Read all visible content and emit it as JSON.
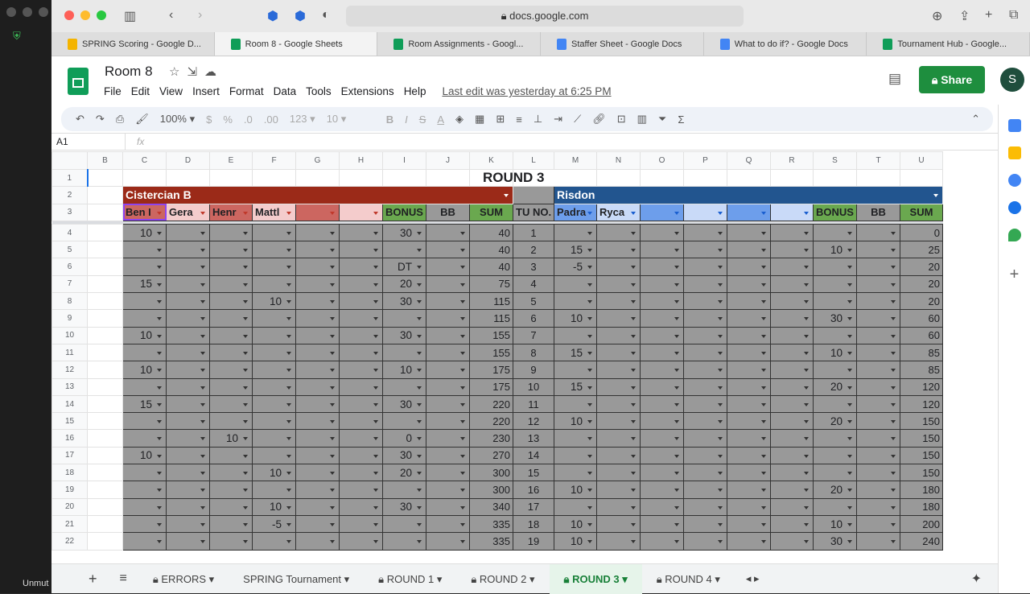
{
  "browser": {
    "url": "docs.google.com",
    "tabs": [
      {
        "label": "SPRING Scoring - Google D...",
        "icon": "drive-icon",
        "color": "#f4b400"
      },
      {
        "label": "Room 8 - Google Sheets",
        "icon": "sheets-icon",
        "color": "#0f9d58",
        "active": true
      },
      {
        "label": "Room Assignments - Googl...",
        "icon": "sheets-icon",
        "color": "#0f9d58"
      },
      {
        "label": "Staffer Sheet - Google Docs",
        "icon": "docs-icon",
        "color": "#4285f4"
      },
      {
        "label": "What to do if? - Google Docs",
        "icon": "docs-icon",
        "color": "#4285f4"
      },
      {
        "label": "Tournament Hub - Google...",
        "icon": "sheets-icon",
        "color": "#0f9d58"
      }
    ]
  },
  "doc": {
    "title": "Room 8",
    "menu": [
      "File",
      "Edit",
      "View",
      "Insert",
      "Format",
      "Data",
      "Tools",
      "Extensions",
      "Help"
    ],
    "last_edit": "Last edit was yesterday at 6:25 PM",
    "share": "Share",
    "avatar": "S"
  },
  "toolbar": {
    "zoom": "100%",
    "currency": "$",
    "percent": "%",
    "dec_less": ".0",
    "dec_more": ".00",
    "format": "123",
    "font_size": "10"
  },
  "formula": {
    "cell": "A1",
    "value": ""
  },
  "zoom_app": {
    "unmute": "Unmut"
  },
  "sheet": {
    "columns": [
      "B",
      "C",
      "D",
      "E",
      "F",
      "G",
      "H",
      "I",
      "J",
      "K",
      "L",
      "M",
      "N",
      "O",
      "P",
      "Q",
      "R",
      "S",
      "T",
      "U"
    ],
    "title": "ROUND 3",
    "team1": "Cistercian B",
    "team2": "Risdon",
    "team1_players": [
      "Ben I",
      "Gera",
      "Henr",
      "Mattl",
      "",
      ""
    ],
    "team2_players": [
      "Padra",
      "Ryca",
      "",
      "",
      "",
      ""
    ],
    "bonus": "BONUS",
    "bb": "BB",
    "sum": "SUM",
    "tu": "TU NO.",
    "rows": [
      {
        "n": "4",
        "t1": [
          "10",
          "",
          "",
          "",
          "",
          ""
        ],
        "b1": "30",
        "s1": "40",
        "tu": "1",
        "t2": [
          "",
          "",
          "",
          "",
          "",
          ""
        ],
        "b2": "",
        "s2": "0"
      },
      {
        "n": "5",
        "t1": [
          "",
          "",
          "",
          "",
          "",
          ""
        ],
        "b1": "",
        "s1": "40",
        "tu": "2",
        "t2": [
          "15",
          "",
          "",
          "",
          "",
          ""
        ],
        "b2": "10",
        "s2": "25"
      },
      {
        "n": "6",
        "t1": [
          "",
          "",
          "",
          "",
          "",
          ""
        ],
        "b1": "DT",
        "s1": "40",
        "tu": "3",
        "t2": [
          "-5",
          "",
          "",
          "",
          "",
          ""
        ],
        "b2": "",
        "s2": "20"
      },
      {
        "n": "7",
        "t1": [
          "15",
          "",
          "",
          "",
          "",
          ""
        ],
        "b1": "20",
        "s1": "75",
        "tu": "4",
        "t2": [
          "",
          "",
          "",
          "",
          "",
          ""
        ],
        "b2": "",
        "s2": "20"
      },
      {
        "n": "8",
        "t1": [
          "",
          "",
          "",
          "10",
          "",
          ""
        ],
        "b1": "30",
        "s1": "115",
        "tu": "5",
        "t2": [
          "",
          "",
          "",
          "",
          "",
          ""
        ],
        "b2": "",
        "s2": "20"
      },
      {
        "n": "9",
        "t1": [
          "",
          "",
          "",
          "",
          "",
          ""
        ],
        "b1": "",
        "s1": "115",
        "tu": "6",
        "t2": [
          "10",
          "",
          "",
          "",
          "",
          ""
        ],
        "b2": "30",
        "s2": "60"
      },
      {
        "n": "10",
        "t1": [
          "10",
          "",
          "",
          "",
          "",
          ""
        ],
        "b1": "30",
        "s1": "155",
        "tu": "7",
        "t2": [
          "",
          "",
          "",
          "",
          "",
          ""
        ],
        "b2": "",
        "s2": "60"
      },
      {
        "n": "11",
        "t1": [
          "",
          "",
          "",
          "",
          "",
          ""
        ],
        "b1": "",
        "s1": "155",
        "tu": "8",
        "t2": [
          "15",
          "",
          "",
          "",
          "",
          ""
        ],
        "b2": "10",
        "s2": "85"
      },
      {
        "n": "12",
        "t1": [
          "10",
          "",
          "",
          "",
          "",
          ""
        ],
        "b1": "10",
        "s1": "175",
        "tu": "9",
        "t2": [
          "",
          "",
          "",
          "",
          "",
          ""
        ],
        "b2": "",
        "s2": "85"
      },
      {
        "n": "13",
        "t1": [
          "",
          "",
          "",
          "",
          "",
          ""
        ],
        "b1": "",
        "s1": "175",
        "tu": "10",
        "t2": [
          "15",
          "",
          "",
          "",
          "",
          ""
        ],
        "b2": "20",
        "s2": "120"
      },
      {
        "n": "14",
        "t1": [
          "15",
          "",
          "",
          "",
          "",
          ""
        ],
        "b1": "30",
        "s1": "220",
        "tu": "11",
        "t2": [
          "",
          "",
          "",
          "",
          "",
          ""
        ],
        "b2": "",
        "s2": "120"
      },
      {
        "n": "15",
        "t1": [
          "",
          "",
          "",
          "",
          "",
          ""
        ],
        "b1": "",
        "s1": "220",
        "tu": "12",
        "t2": [
          "10",
          "",
          "",
          "",
          "",
          ""
        ],
        "b2": "20",
        "s2": "150"
      },
      {
        "n": "16",
        "t1": [
          "",
          "",
          "10",
          "",
          "",
          ""
        ],
        "b1": "0",
        "s1": "230",
        "tu": "13",
        "t2": [
          "",
          "",
          "",
          "",
          "",
          ""
        ],
        "b2": "",
        "s2": "150"
      },
      {
        "n": "17",
        "t1": [
          "10",
          "",
          "",
          "",
          "",
          ""
        ],
        "b1": "30",
        "s1": "270",
        "tu": "14",
        "t2": [
          "",
          "",
          "",
          "",
          "",
          ""
        ],
        "b2": "",
        "s2": "150"
      },
      {
        "n": "18",
        "t1": [
          "",
          "",
          "",
          "10",
          "",
          ""
        ],
        "b1": "20",
        "s1": "300",
        "tu": "15",
        "t2": [
          "",
          "",
          "",
          "",
          "",
          ""
        ],
        "b2": "",
        "s2": "150"
      },
      {
        "n": "19",
        "t1": [
          "",
          "",
          "",
          "",
          "",
          ""
        ],
        "b1": "",
        "s1": "300",
        "tu": "16",
        "t2": [
          "10",
          "",
          "",
          "",
          "",
          ""
        ],
        "b2": "20",
        "s2": "180"
      },
      {
        "n": "20",
        "t1": [
          "",
          "",
          "",
          "10",
          "",
          ""
        ],
        "b1": "30",
        "s1": "340",
        "tu": "17",
        "t2": [
          "",
          "",
          "",
          "",
          "",
          ""
        ],
        "b2": "",
        "s2": "180"
      },
      {
        "n": "21",
        "t1": [
          "",
          "",
          "",
          "-5",
          "",
          ""
        ],
        "b1": "",
        "s1": "335",
        "tu": "18",
        "t2": [
          "10",
          "",
          "",
          "",
          "",
          ""
        ],
        "b2": "10",
        "s2": "200"
      },
      {
        "n": "22",
        "t1": [
          "",
          "",
          "",
          "",
          "",
          ""
        ],
        "b1": "",
        "s1": "335",
        "tu": "19",
        "t2": [
          "10",
          "",
          "",
          "",
          "",
          ""
        ],
        "b2": "30",
        "s2": "240"
      }
    ]
  },
  "sheet_tabs": [
    {
      "label": "ERRORS",
      "locked": true
    },
    {
      "label": "SPRING Tournament"
    },
    {
      "label": "ROUND 1",
      "locked": true
    },
    {
      "label": "ROUND 2",
      "locked": true
    },
    {
      "label": "ROUND 3",
      "locked": true,
      "active": true
    },
    {
      "label": "ROUND 4",
      "locked": true
    }
  ]
}
